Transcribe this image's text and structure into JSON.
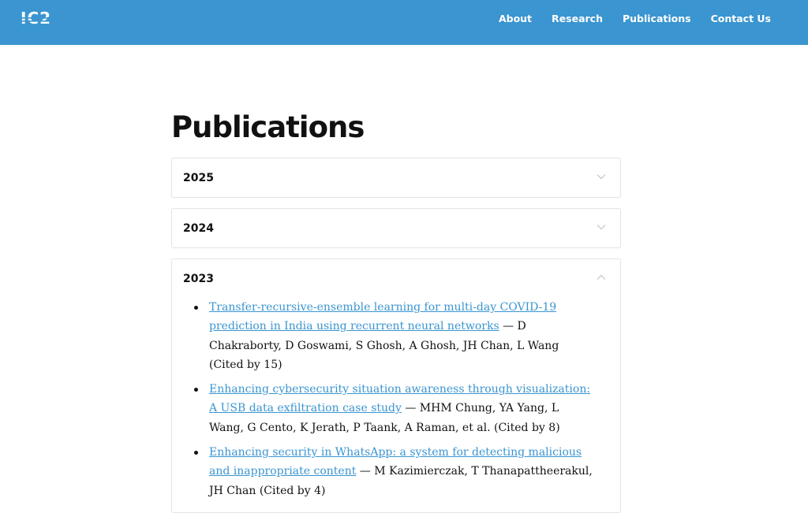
{
  "header": {
    "logo_text": "IC2",
    "nav": [
      {
        "label": "About"
      },
      {
        "label": "Research"
      },
      {
        "label": "Publications"
      },
      {
        "label": "Contact Us"
      }
    ]
  },
  "colors": {
    "brand": "#3a95d0",
    "link": "#3a95d0",
    "text": "#111111",
    "border": "#e3e3e3"
  },
  "main": {
    "title": "Publications",
    "sections": [
      {
        "year": "2025",
        "expanded": false,
        "icon": "chevron-down-icon"
      },
      {
        "year": "2024",
        "expanded": false,
        "icon": "chevron-down-icon"
      },
      {
        "year": "2023",
        "expanded": true,
        "icon": "chevron-up-icon",
        "publications": [
          {
            "title": "Transfer-recursive-ensemble learning for multi-day COVID-19 prediction in India using recurrent neural networks",
            "details": " — D Chakraborty, D Goswami, S Ghosh, A Ghosh, JH Chan, L Wang (Cited by 15)"
          },
          {
            "title": "Enhancing cybersecurity situation awareness through visualization: A USB data exfiltration case study",
            "details": " — MHM Chung, YA Yang, L Wang, G Cento, K Jerath, P Taank, A Raman, et al. (Cited by 8)"
          },
          {
            "title": "Enhancing security in WhatsApp: a system for detecting malicious and inappropriate content",
            "details": " — M Kazimierczak, T Thanapattheerakul, JH Chan (Cited by 4)"
          }
        ]
      }
    ]
  }
}
